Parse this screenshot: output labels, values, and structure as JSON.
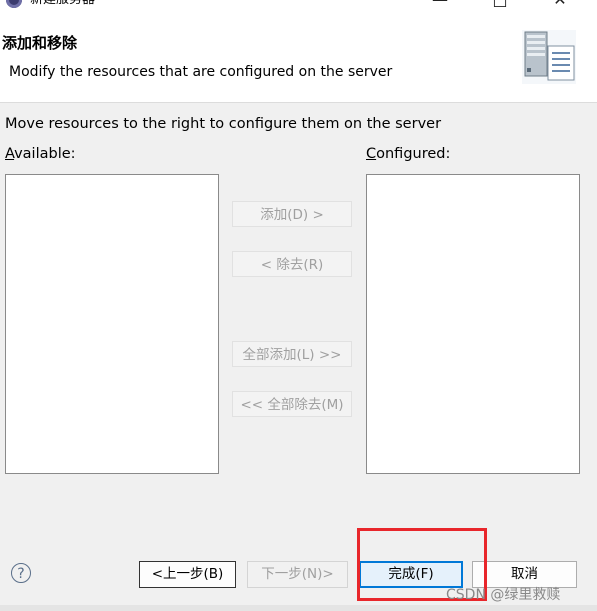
{
  "window": {
    "title": "新建服务器",
    "minimize_glyph": "—",
    "maximize_glyph": "□",
    "close_glyph": "✕"
  },
  "header": {
    "title": "添加和移除",
    "description": "Modify the resources that are configured on the server",
    "image_icon": "server-wizard-banner-icon"
  },
  "instruction": "Move resources to the right to configure them on the server",
  "available": {
    "label_first": "A",
    "label_rest": "vailable:",
    "items": []
  },
  "configured": {
    "label_first": "C",
    "label_rest": "onfigured:",
    "items": []
  },
  "transfer_buttons": {
    "add": "添加(D) >",
    "remove": "< 除去(R)",
    "add_all": "全部添加(L) >>",
    "remove_all": "<< 全部除去(M)"
  },
  "footer": {
    "help_glyph": "?",
    "back": "<上一步(B)",
    "next": "下一步(N)>",
    "finish": "完成(F)",
    "cancel": "取消"
  },
  "watermark": "CSDN @绿里救赎",
  "colors": {
    "accent": "#0078d7",
    "highlight_box": "#e8262b",
    "disabled_text": "#a0a0a0"
  }
}
